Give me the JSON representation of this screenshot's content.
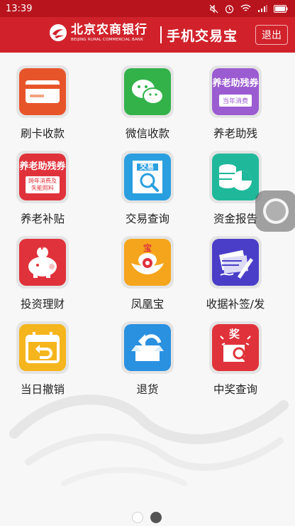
{
  "status_bar": {
    "time": "13:39"
  },
  "header": {
    "bank_name_cn": "北京农商银行",
    "bank_name_en": "BEIJING RURAL COMMERCIAL BANK",
    "app_title": "手机交易宝",
    "logout_label": "退出"
  },
  "tiles": [
    {
      "label": "刷卡收款",
      "icon": "card-icon",
      "color": "#e8542a"
    },
    {
      "label": "微信收款",
      "icon": "wechat-icon",
      "color": "#33b24a"
    },
    {
      "label": "养老助残",
      "icon": "voucher-icon",
      "color": "#9b5bd1",
      "icon_text": "养老助残券",
      "icon_subtext": "当年消费"
    },
    {
      "label": "养老补贴",
      "icon": "voucher-subsidy-icon",
      "color": "#e0323b",
      "icon_text": "养老助残券",
      "icon_subtext": "跨年消费及失能照料"
    },
    {
      "label": "交易查询",
      "icon": "transaction-search-icon",
      "color": "#2a9fe0",
      "icon_text": "交易"
    },
    {
      "label": "资金报告",
      "icon": "fund-report-icon",
      "color": "#1fb89a"
    },
    {
      "label": "投资理财",
      "icon": "piggy-bank-icon",
      "color": "#e0323b",
      "icon_text": "¥"
    },
    {
      "label": "凤凰宝",
      "icon": "gold-ingot-icon",
      "color": "#f5a51c",
      "icon_text": "宝"
    },
    {
      "label": "收据补签/发",
      "icon": "receipt-sign-icon",
      "color": "#4a3ec8"
    },
    {
      "label": "当日撤销",
      "icon": "calendar-undo-icon",
      "color": "#f5b51c"
    },
    {
      "label": "退货",
      "icon": "return-box-icon",
      "color": "#2a90e0"
    },
    {
      "label": "中奖查询",
      "icon": "prize-search-icon",
      "color": "#e0323b",
      "icon_text": "奖"
    }
  ]
}
